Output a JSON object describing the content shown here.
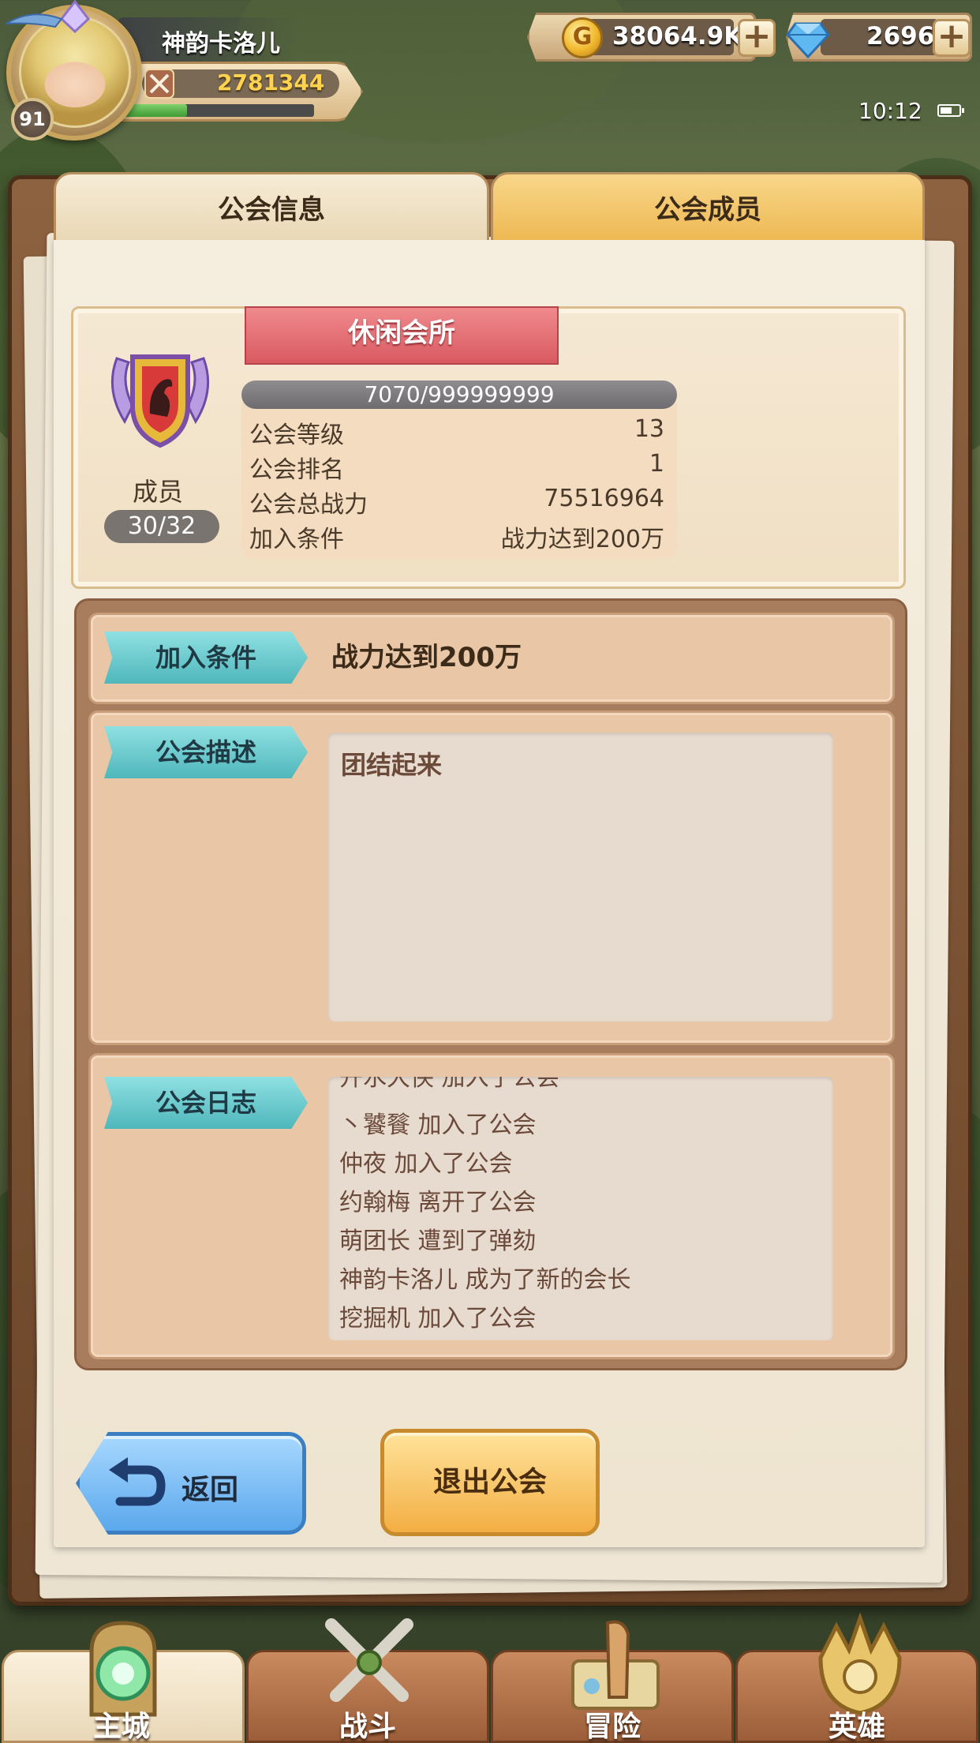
{
  "player": {
    "name": "神韵卡洛儿",
    "level": "91",
    "power": "2781344",
    "exp_fraction": 0.33
  },
  "resources": {
    "gold": "38064.9K",
    "diamonds": "2696",
    "plus": "+"
  },
  "status_bar": {
    "time": "10:12"
  },
  "tabs": {
    "info": "公会信息",
    "members": "公会成员"
  },
  "guild": {
    "name": "休闲会所",
    "exp": "7070/999999999",
    "members_label": "成员",
    "members_count": "30/32",
    "stats": [
      {
        "label": "公会等级",
        "value": "13"
      },
      {
        "label": "公会排名",
        "value": "1"
      },
      {
        "label": "公会总战力",
        "value": "75516964"
      },
      {
        "label": "加入条件",
        "value": "战力达到200万"
      }
    ]
  },
  "details": {
    "join_tag": "加入条件",
    "join_value": "战力达到200万",
    "desc_tag": "公会描述",
    "desc_text": "团结起来",
    "log_tag": "公会日志",
    "log_partial": "开水大侠 加入了公会",
    "log_lines": [
      "丶饕餮 加入了公会",
      "仲夜 加入了公会",
      "约翰梅 离开了公会",
      "萌团长 遭到了弹劾",
      "神韵卡洛儿 成为了新的会长",
      "挖掘机 加入了公会"
    ]
  },
  "buttons": {
    "back": "返回",
    "quit": "退出公会"
  },
  "nav": {
    "main_city": "主城",
    "battle": "战斗",
    "adventure": "冒险",
    "heroes": "英雄"
  },
  "colors": {
    "selected_tab": "#eeb954",
    "section_tag": "#4fb7bb",
    "ribbon": "#d95a61",
    "back_button": "#5ba8ec",
    "quit_button": "#f3ae43"
  }
}
